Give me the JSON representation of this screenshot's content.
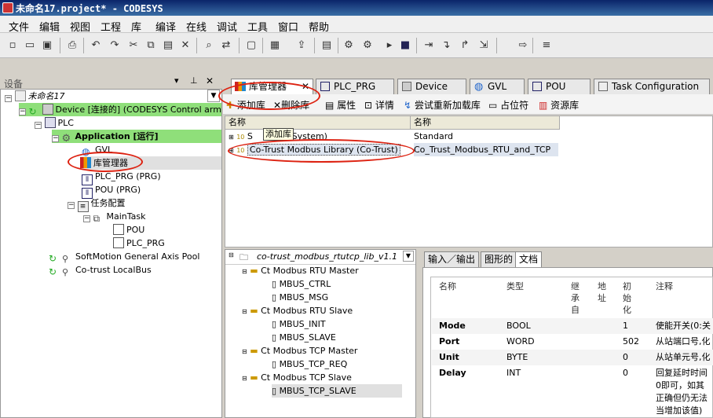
{
  "window": {
    "title": "未命名17.project* - CODESYS"
  },
  "menu": [
    "文件",
    "编辑",
    "视图",
    "工程",
    "库",
    "编译",
    "在线",
    "调试",
    "工具",
    "窗口",
    "帮助"
  ],
  "left_panel": {
    "title": "设备",
    "tree": [
      {
        "label": "未命名17"
      },
      {
        "label": "Device [连接的] (CODESYS Control arm C"
      },
      {
        "label": "PLC"
      },
      {
        "label": "Application [运行]"
      },
      {
        "label": "GVL"
      },
      {
        "label": "库管理器"
      },
      {
        "label": "PLC_PRG (PRG)"
      },
      {
        "label": "POU (PRG)"
      },
      {
        "label": "任务配置"
      },
      {
        "label": "MainTask"
      },
      {
        "label": "POU"
      },
      {
        "label": "PLC_PRG"
      },
      {
        "label": "SoftMotion General Axis Pool"
      },
      {
        "label": "Co-trust LocalBus"
      }
    ]
  },
  "tabs": [
    "库管理器",
    "PLC_PRG",
    "Device",
    "GVL",
    "POU",
    "Task Configuration"
  ],
  "lib_toolbar": [
    "添加库",
    "删除库",
    "属性",
    "详情",
    "尝试重新加载库",
    "占位符",
    "资源库"
  ],
  "lib_grid": {
    "columns": [
      "名称",
      "名称"
    ],
    "tooltip": "添加库",
    "rows": [
      {
        "name": "(System)",
        "name_prefix": "S",
        "col2": "Standard"
      },
      {
        "name": "Co-Trust Modbus Library (Co-Trust)",
        "col2": "Co_Trust_Modbus_RTU_and_TCP"
      }
    ]
  },
  "lib_tree": {
    "root": "co-trust_modbus_rtutcp_lib_v1.1",
    "items": [
      {
        "label": "Ct Modbus RTU Master",
        "level": 1
      },
      {
        "label": "MBUS_CTRL",
        "level": 2
      },
      {
        "label": "MBUS_MSG",
        "level": 2
      },
      {
        "label": "Ct Modbus RTU Slave",
        "level": 1
      },
      {
        "label": "MBUS_INIT",
        "level": 2
      },
      {
        "label": "MBUS_SLAVE",
        "level": 2
      },
      {
        "label": "Ct Modbus TCP Master",
        "level": 1
      },
      {
        "label": "MBUS_TCP_REQ",
        "level": 2
      },
      {
        "label": "Ct Modbus TCP Slave",
        "level": 1
      },
      {
        "label": "MBUS_TCP_SLAVE",
        "level": 2
      }
    ]
  },
  "doc_tabs": [
    "输入／输出",
    "图形的",
    "文档"
  ],
  "doc_table": {
    "headers": {
      "name": "名称",
      "type": "类型",
      "inherit": "继承自",
      "addr": "地址",
      "init": "初始化",
      "comment": "注释"
    },
    "rows": [
      {
        "name": "Mode",
        "type": "BOOL",
        "init": "1",
        "comment": "使能开关(0:关"
      },
      {
        "name": "Port",
        "type": "WORD",
        "init": "502",
        "comment": "从站端口号,化"
      },
      {
        "name": "Unit",
        "type": "BYTE",
        "init": "0",
        "comment": "从站单元号,化"
      },
      {
        "name": "Delay",
        "type": "INT",
        "init": "0",
        "comment": "回复延时时间"
      }
    ],
    "comment_more": [
      "0即可，如其",
      "正确但仍无法",
      "当增加该值)"
    ]
  },
  "colors": {
    "annotation": "#d21111",
    "running": "#8fdf7a"
  }
}
